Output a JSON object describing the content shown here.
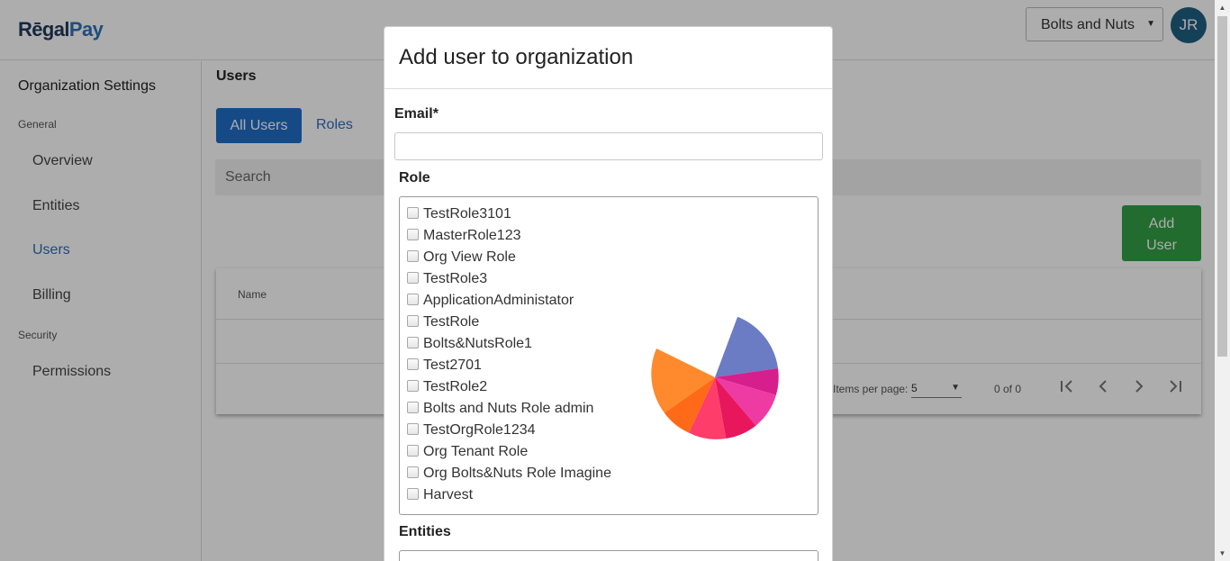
{
  "app": {
    "logo_part1": "RēgalPay",
    "logo_part2": "Pay",
    "logo_part1_short": "Rēgal"
  },
  "header": {
    "org_selected": "Bolts and Nuts",
    "avatar_initials": "JR"
  },
  "sidebar": {
    "title": "Organization Settings",
    "sections": [
      {
        "label": "General",
        "items": [
          "Overview",
          "Entities",
          "Users",
          "Billing"
        ]
      },
      {
        "label": "Security",
        "items": [
          "Permissions"
        ]
      }
    ],
    "active_item": "Users"
  },
  "main": {
    "title": "Users",
    "tabs": [
      "All Users",
      "Roles"
    ],
    "active_tab": "All Users",
    "search_placeholder": "Search",
    "add_user_line1": "Add",
    "add_user_line2": "User",
    "table": {
      "columns": [
        "Name"
      ],
      "rows": [],
      "items_per_page_label": "Items per page:",
      "items_per_page_value": "5",
      "range_label": "0 of 0"
    }
  },
  "modal": {
    "title": "Add user to organization",
    "email_label": "Email*",
    "email_value": "",
    "role_label": "Role",
    "roles": [
      "TestRole3101",
      "MasterRole123",
      "Org View Role",
      "TestRole3",
      "ApplicationAdministator",
      "TestRole",
      "Bolts&NutsRole1",
      "Test2701",
      "TestRole2",
      "Bolts and Nuts Role admin",
      "TestOrgRole1234",
      "Org Tenant Role",
      "Org Bolts&Nuts Role Imagine",
      "Harvest"
    ],
    "entities_label": "Entities",
    "loading_graphic_colors": [
      "#6b7bc4",
      "#d61e8c",
      "#ee3aa3",
      "#e8175d",
      "#ff3d6b",
      "#ff6a18",
      "#ff8a2d"
    ]
  },
  "colors": {
    "primary": "#1f6dc8",
    "link": "#2d6cc0",
    "success": "#31a045",
    "avatar": "#1e5f82"
  }
}
